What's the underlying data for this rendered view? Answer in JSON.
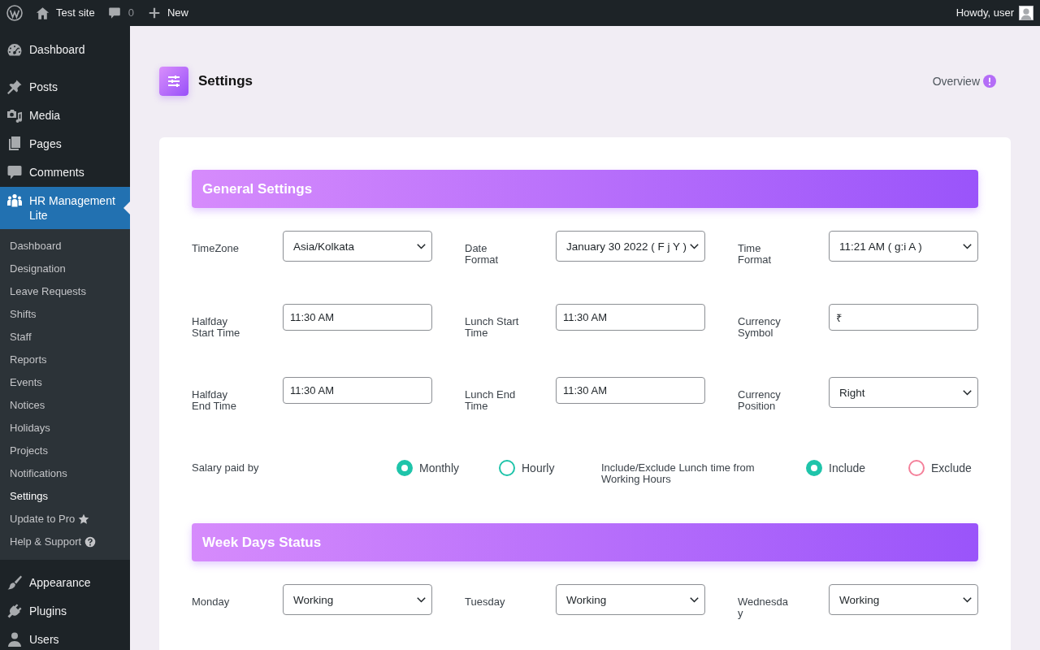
{
  "admin_bar": {
    "site_name": "Test site",
    "comment_count": "0",
    "new_label": "New",
    "greeting": "Howdy, user"
  },
  "sidebar": {
    "groups": [
      {
        "items": [
          {
            "label": "Dashboard",
            "selected": false
          }
        ]
      },
      {
        "items": [
          {
            "label": "Posts",
            "selected": false
          },
          {
            "label": "Media",
            "selected": false
          },
          {
            "label": "Pages",
            "selected": false
          },
          {
            "label": "Comments",
            "selected": false
          },
          {
            "label": "HR Management Lite",
            "selected": true,
            "children": [
              {
                "label": "Dashboard",
                "selected": false,
                "kind": "link"
              },
              {
                "label": "Designation",
                "selected": false,
                "kind": "link"
              },
              {
                "label": "Leave Requests",
                "selected": false,
                "kind": "link"
              },
              {
                "label": "Shifts",
                "selected": false,
                "kind": "link"
              },
              {
                "label": "Staff",
                "selected": false,
                "kind": "link"
              },
              {
                "label": "Reports",
                "selected": false,
                "kind": "link"
              },
              {
                "label": "Events",
                "selected": false,
                "kind": "link"
              },
              {
                "label": "Notices",
                "selected": false,
                "kind": "link"
              },
              {
                "label": "Holidays",
                "selected": false,
                "kind": "link"
              },
              {
                "label": "Projects",
                "selected": false,
                "kind": "link"
              },
              {
                "label": "Notifications",
                "selected": false,
                "kind": "link"
              },
              {
                "label": "Settings",
                "selected": true,
                "kind": "link"
              },
              {
                "label": "Update to Pro",
                "selected": false,
                "kind": "upgrade"
              },
              {
                "label": "Help & Support",
                "selected": false,
                "kind": "help"
              }
            ]
          }
        ]
      },
      {
        "items": [
          {
            "label": "Appearance",
            "selected": false
          },
          {
            "label": "Plugins",
            "selected": false
          },
          {
            "label": "Users",
            "selected": false
          }
        ]
      }
    ]
  },
  "page_header": {
    "title": "Settings",
    "link": "Overview"
  },
  "sections": [
    {
      "title": "General Settings",
      "fields": [
        {
          "label": "TimeZone",
          "kind": "select",
          "value": "Asia/Kolkata"
        },
        {
          "label": "Date Format",
          "kind": "select",
          "value": "January 30 2022 ( F j Y )"
        },
        {
          "label": "Time Format",
          "kind": "select",
          "value": "11:21 AM ( g:i A )"
        },
        {
          "label": "Halfday Start Time",
          "kind": "text",
          "value": "11:30 AM"
        },
        {
          "label": "Lunch Start Time",
          "kind": "text",
          "value": "11:30 AM"
        },
        {
          "label": "Currency Symbol",
          "kind": "text",
          "value": "₹"
        },
        {
          "label": "Halfday End Time",
          "kind": "text",
          "value": "11:30 AM"
        },
        {
          "label": "Lunch End Time",
          "kind": "text",
          "value": "11:30 AM"
        },
        {
          "label": "Currency Position",
          "kind": "select",
          "value": "Right"
        }
      ],
      "radio_groups": [
        {
          "label": "Salary paid by",
          "options": [
            {
              "label": "Monthly",
              "selected": true,
              "color": "#1fc4aa"
            },
            {
              "label": "Hourly",
              "selected": false,
              "color": "#1fc4aa"
            }
          ]
        },
        {
          "label": "Include/Exclude Lunch time from Working Hours",
          "options": [
            {
              "label": "Include",
              "selected": true,
              "color": "#1fc4aa"
            },
            {
              "label": "Exclude",
              "selected": false,
              "color": "#f4809a"
            }
          ]
        }
      ]
    },
    {
      "title": "Week Days Status",
      "fields": [
        {
          "label": "Monday",
          "kind": "select",
          "value": "Working"
        },
        {
          "label": "Tuesday",
          "kind": "select",
          "value": "Working"
        },
        {
          "label": "Wednesday",
          "kind": "select",
          "value": "Working"
        }
      ]
    }
  ]
}
